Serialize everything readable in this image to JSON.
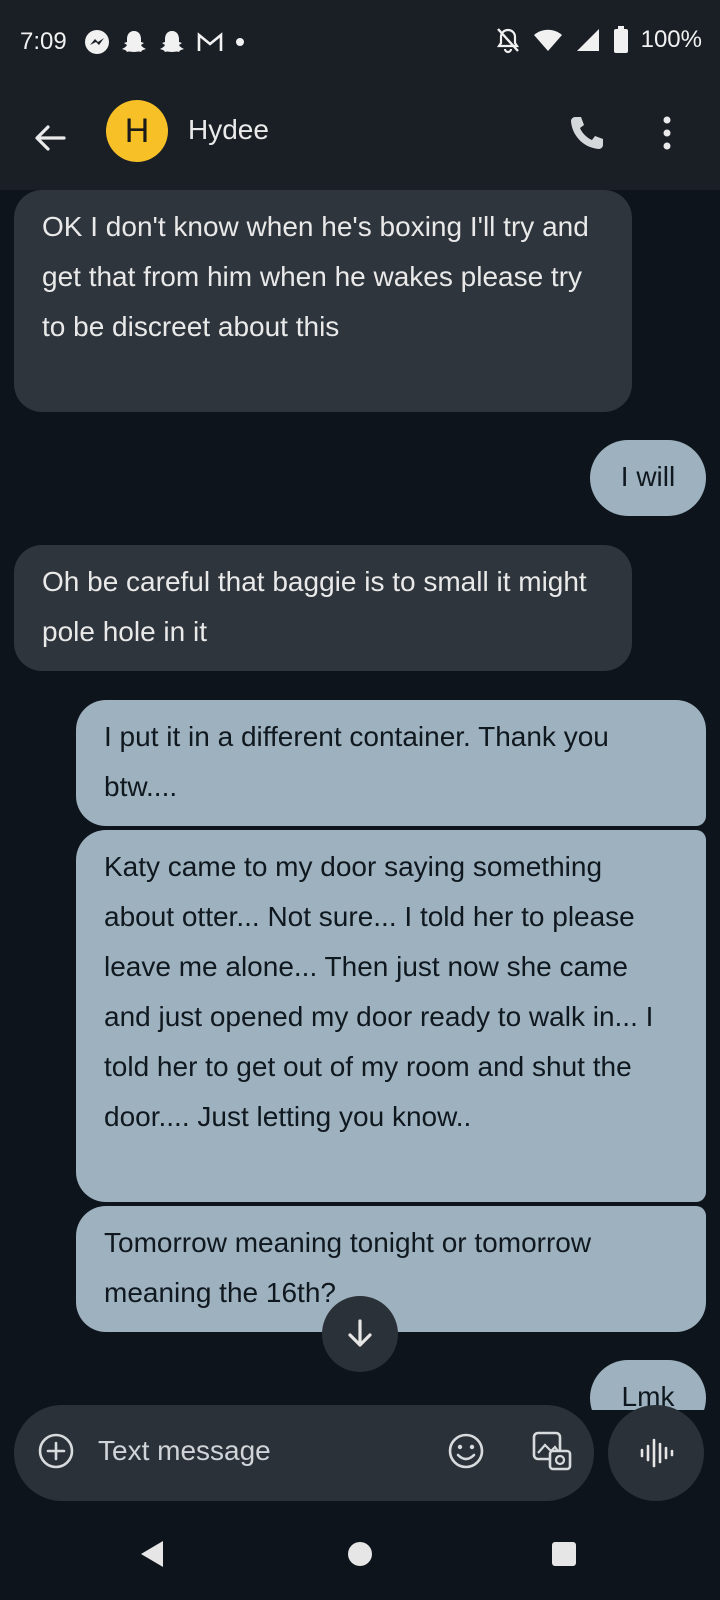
{
  "status_bar": {
    "time": "7:09",
    "battery": "100%",
    "left_icons": [
      "messenger-icon",
      "snapchat-icon",
      "snapchat-icon",
      "gmail-icon",
      "dot-icon"
    ],
    "right_icons": [
      "mute-icon",
      "wifi-icon",
      "signal-icon",
      "battery-icon"
    ]
  },
  "header": {
    "avatar_letter": "H",
    "contact_name": "Hydee",
    "avatar_color": "#f6c026"
  },
  "messages": [
    {
      "direction": "incoming",
      "text": "OK I don't know when he's boxing I'll try and get that from him when he wakes please try to be discreet about this"
    },
    {
      "direction": "outgoing",
      "text": "I will"
    },
    {
      "direction": "incoming",
      "text": "Oh be careful that baggie is to small it might pole hole in it"
    },
    {
      "direction": "outgoing",
      "text": "I put it in a different container. Thank you btw...."
    },
    {
      "direction": "outgoing",
      "text": "Katy came to my door saying something about otter... Not sure... I told her to please leave me alone... Then just now she came and just opened my door ready to walk in... I told her to get out of my room and shut the door.... Just letting you know.."
    },
    {
      "direction": "outgoing",
      "text": "Tomorrow meaning tonight or tomorrow meaning the 16th?"
    },
    {
      "direction": "outgoing",
      "text": "Lmk"
    }
  ],
  "composer": {
    "placeholder": "Text message"
  },
  "colors": {
    "background": "#0e141b",
    "incoming_bubble": "#2f353c",
    "outgoing_bubble": "#9eb1bf",
    "bar": "#1a1f26"
  }
}
